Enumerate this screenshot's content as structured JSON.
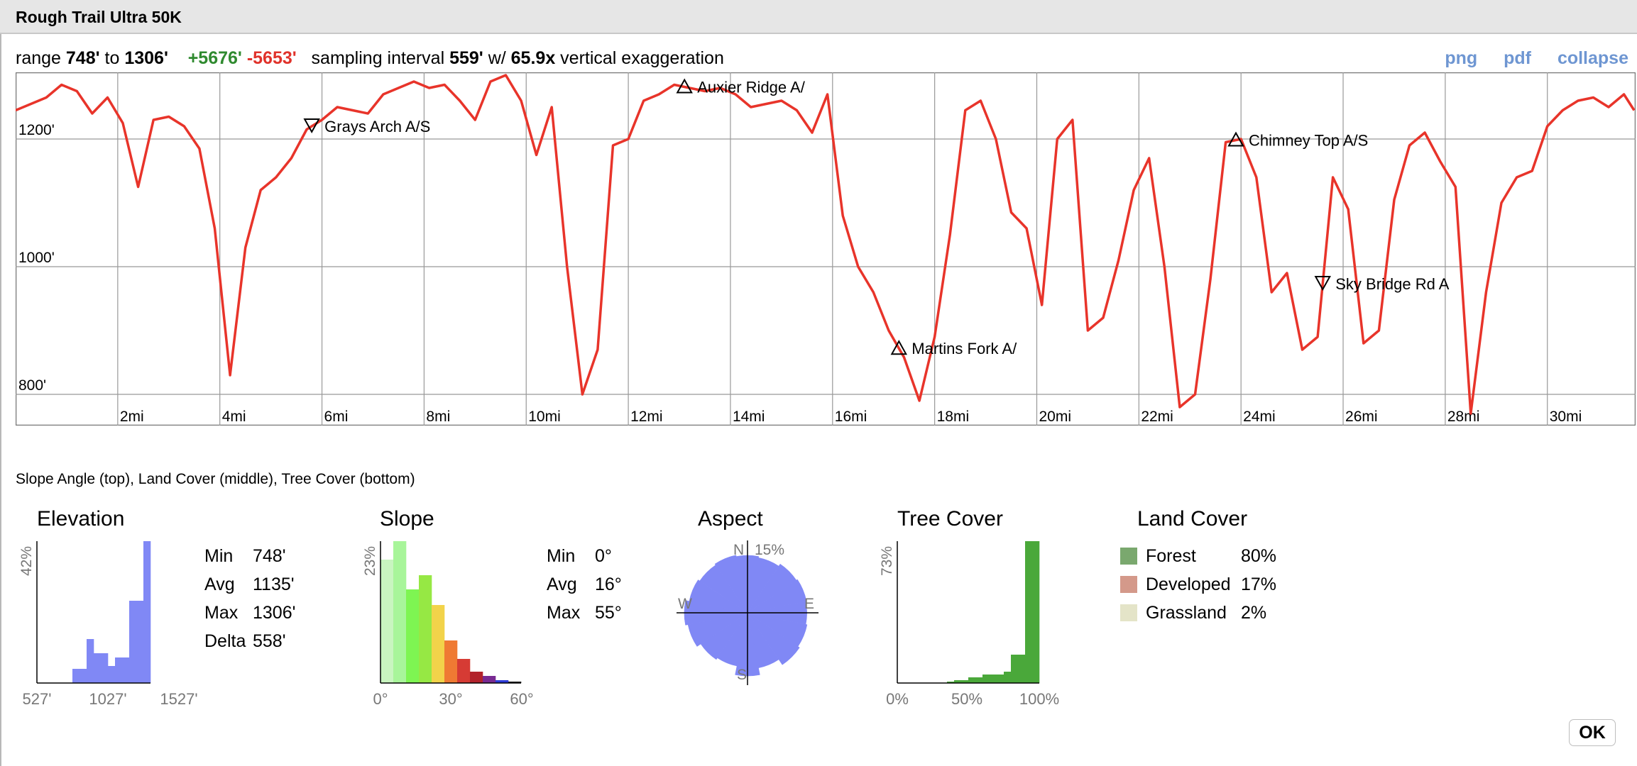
{
  "title": "Rough Trail Ultra 50K",
  "summary": {
    "range_label": "range",
    "min": "748'",
    "to_label": "to",
    "max": "1306'",
    "gain": "+5676'",
    "loss": "-5653'",
    "sampling_label": "sampling interval",
    "interval": "559'",
    "with_label": "w/",
    "exaggeration": "65.9x",
    "exaggeration_label": "vertical exaggeration"
  },
  "links": {
    "png": "png",
    "pdf": "pdf",
    "collapse": "collapse"
  },
  "colors": {
    "profile_line": "#e8342a",
    "histogram": "#8088f5",
    "gain": "#2f8a2f",
    "loss": "#e0322a",
    "link": "#6e96d2",
    "tree_cover": "#4aa83a"
  },
  "chart_data": {
    "type": "line",
    "x_unit": "mi",
    "y_unit": "ft",
    "xlim": [
      0,
      31.7
    ],
    "ylim": [
      748,
      1306
    ],
    "x_ticks": [
      "2mi",
      "4mi",
      "6mi",
      "8mi",
      "10mi",
      "12mi",
      "14mi",
      "16mi",
      "18mi",
      "20mi",
      "22mi",
      "24mi",
      "26mi",
      "28mi",
      "30mi"
    ],
    "y_ticks": [
      "1200'",
      "1000'",
      "800'"
    ],
    "grid": true,
    "series": [
      {
        "x": [
          0,
          0.3,
          0.6,
          0.9,
          1.2,
          1.5,
          1.8,
          2.1,
          2.4,
          2.7,
          3.0,
          3.3,
          3.6,
          3.9,
          4.2,
          4.5,
          4.8,
          5.1,
          5.4,
          5.7,
          6.0,
          6.3,
          6.6,
          6.9,
          7.2,
          7.5,
          7.8,
          8.1,
          8.4,
          8.7,
          9.0,
          9.3,
          9.6,
          9.9,
          10.2,
          10.5,
          10.8,
          11.1,
          11.4,
          11.7,
          12.0,
          12.3,
          12.6,
          12.9,
          13.2,
          13.5,
          13.8,
          14.1,
          14.4,
          14.7,
          15.0,
          15.3,
          15.6,
          15.9,
          16.2,
          16.5,
          16.8,
          17.1,
          17.4,
          17.7,
          18.0,
          18.3,
          18.6,
          18.9,
          19.2,
          19.5,
          19.8,
          20.1,
          20.4,
          20.7,
          21.0,
          21.3,
          21.6,
          21.9,
          22.2,
          22.5,
          22.8,
          23.1,
          23.4,
          23.7,
          24.0,
          24.3,
          24.6,
          24.9,
          25.2,
          25.5,
          25.8,
          26.1,
          26.4,
          26.7,
          27.0,
          27.3,
          27.6,
          27.9,
          28.2,
          28.5,
          28.8,
          29.1,
          29.4,
          29.7,
          30.0,
          30.3,
          30.6,
          30.9,
          31.2,
          31.5,
          31.7
        ],
        "y": [
          1245,
          1255,
          1265,
          1285,
          1275,
          1240,
          1265,
          1225,
          1125,
          1230,
          1235,
          1220,
          1185,
          1060,
          830,
          1030,
          1120,
          1140,
          1170,
          1215,
          1230,
          1250,
          1245,
          1240,
          1270,
          1280,
          1290,
          1280,
          1285,
          1260,
          1230,
          1290,
          1300,
          1260,
          1175,
          1250,
          1000,
          800,
          870,
          1190,
          1200,
          1260,
          1270,
          1285,
          1280,
          1275,
          1280,
          1270,
          1250,
          1255,
          1260,
          1245,
          1210,
          1270,
          1080,
          1000,
          960,
          900,
          858,
          790,
          890,
          1050,
          1245,
          1260,
          1200,
          1085,
          1060,
          940,
          1200,
          1230,
          900,
          920,
          1010,
          1120,
          1170,
          1000,
          780,
          800,
          980,
          1195,
          1200,
          1140,
          960,
          990,
          870,
          890,
          1140,
          1090,
          880,
          900,
          1105,
          1190,
          1210,
          1165,
          1125,
          770,
          960,
          1100,
          1140,
          1150,
          1220,
          1245,
          1260,
          1265,
          1250,
          1270,
          1245
        ]
      }
    ],
    "annotations": [
      {
        "label": "Grays Arch A/S",
        "x": 5.8,
        "symbol": "down"
      },
      {
        "label": "Auxier Ridge A/",
        "x": 13.1,
        "symbol": "up"
      },
      {
        "label": "Martins Fork A/",
        "x": 17.3,
        "symbol": "up"
      },
      {
        "label": "Chimney Top A/S",
        "x": 23.9,
        "symbol": "up"
      },
      {
        "label": "Sky Bridge Rd A",
        "x": 25.6,
        "symbol": "down"
      }
    ]
  },
  "strip_caption": "Slope Angle (top), Land Cover (middle), Tree Cover (bottom)",
  "elevation": {
    "title": "Elevation",
    "max_pct_label": "42%",
    "x_labels": [
      "527'",
      "1027'",
      "1527'"
    ],
    "bins_pct": [
      0,
      0,
      0,
      0,
      0,
      10,
      10,
      31,
      21,
      21,
      12,
      18,
      18,
      58,
      58,
      100
    ],
    "stats": [
      {
        "label": "Min",
        "value": "748'"
      },
      {
        "label": "Avg",
        "value": "1135'"
      },
      {
        "label": "Max",
        "value": "1306'"
      },
      {
        "label": "Delta",
        "value": "558'"
      }
    ]
  },
  "slope": {
    "title": "Slope",
    "max_pct_label": "23%",
    "x_labels": [
      "0°",
      "30°",
      "60°"
    ],
    "bins_pct": [
      87,
      100,
      66,
      76,
      55,
      30,
      17,
      8,
      5,
      2,
      1
    ],
    "bin_colors": [
      "#c9f5c0",
      "#a8f59a",
      "#7ef552",
      "#96e844",
      "#f2d34a",
      "#ef7a33",
      "#d63b34",
      "#b2232c",
      "#782a92",
      "#2e3bd6",
      "#111111"
    ],
    "stats": [
      {
        "label": "Min",
        "value": "0°"
      },
      {
        "label": "Avg",
        "value": "16°"
      },
      {
        "label": "Max",
        "value": "55°"
      }
    ]
  },
  "aspect": {
    "title": "Aspect",
    "n": "N",
    "s": "S",
    "e": "E",
    "w": "W",
    "ring_label": "15%",
    "sector_values": [
      0.9,
      0.88,
      0.92,
      0.94,
      0.93,
      0.95,
      0.98,
      0.88,
      0.99,
      0.85,
      0.88,
      0.95,
      0.99,
      0.93,
      0.9,
      0.92
    ]
  },
  "tree_cover": {
    "title": "Tree Cover",
    "max_pct_label": "73%",
    "x_labels": [
      "0%",
      "50%",
      "100%"
    ],
    "bins_pct": [
      0,
      0,
      0,
      0,
      0,
      0,
      0,
      1,
      2,
      2,
      4,
      4,
      6,
      6,
      6,
      8,
      20,
      20,
      100,
      100
    ]
  },
  "land_cover": {
    "title": "Land Cover",
    "items": [
      {
        "name": "Forest",
        "pct": "80%",
        "color": "#7aa86e"
      },
      {
        "name": "Developed",
        "pct": "17%",
        "color": "#d4998a"
      },
      {
        "name": "Grassland",
        "pct": "2%",
        "color": "#e4e4c8"
      }
    ]
  },
  "ok_label": "OK"
}
